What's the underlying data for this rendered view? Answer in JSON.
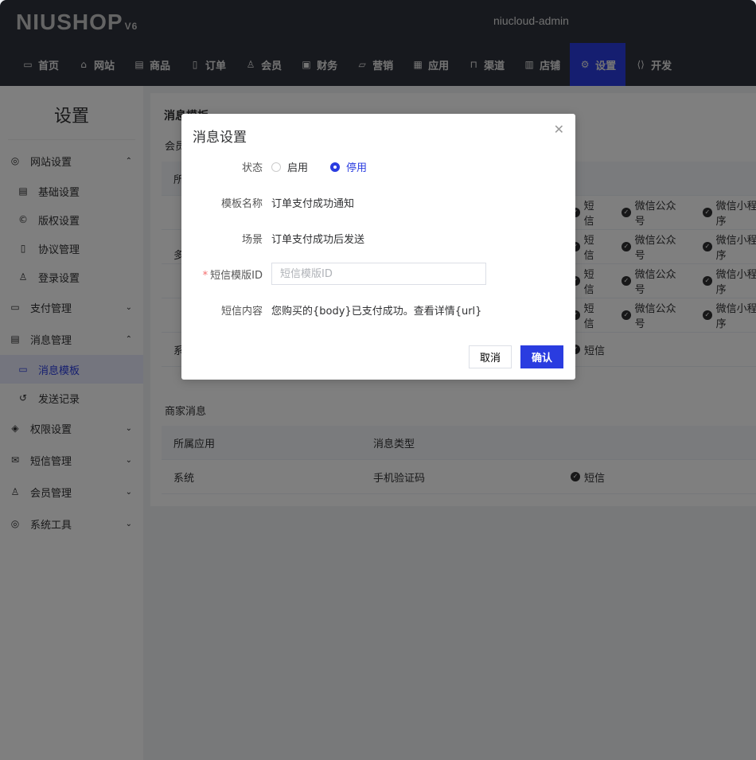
{
  "header": {
    "logo": "NIUSHOP",
    "logo_version": "V6",
    "user": "niucloud-admin",
    "nav": [
      {
        "label": "首页",
        "icon": "monitor-icon"
      },
      {
        "label": "网站",
        "icon": "website-icon"
      },
      {
        "label": "商品",
        "icon": "goods-icon"
      },
      {
        "label": "订单",
        "icon": "order-icon"
      },
      {
        "label": "会员",
        "icon": "member-icon"
      },
      {
        "label": "财务",
        "icon": "finance-icon"
      },
      {
        "label": "营销",
        "icon": "marketing-icon"
      },
      {
        "label": "应用",
        "icon": "app-icon"
      },
      {
        "label": "渠道",
        "icon": "channel-icon"
      },
      {
        "label": "店铺",
        "icon": "store-icon"
      },
      {
        "label": "设置",
        "icon": "gear-icon",
        "active": true
      },
      {
        "label": "开发",
        "icon": "code-icon"
      }
    ]
  },
  "sidebar": {
    "title": "设置",
    "items": [
      {
        "label": "网站设置",
        "icon": "globe-icon"
      },
      {
        "label": "基础设置",
        "icon": "settings-icon"
      },
      {
        "label": "版权设置",
        "icon": "copyright-icon"
      },
      {
        "label": "协议管理",
        "icon": "document-icon"
      },
      {
        "label": "登录设置",
        "icon": "user-icon"
      },
      {
        "label": "支付管理",
        "icon": "wallet-icon"
      },
      {
        "label": "消息管理",
        "icon": "message-icon"
      },
      {
        "label": "消息模板",
        "icon": "chat-icon"
      },
      {
        "label": "发送记录",
        "icon": "history-icon"
      },
      {
        "label": "权限设置",
        "icon": "shield-icon"
      },
      {
        "label": "短信管理",
        "icon": "mail-icon"
      },
      {
        "label": "会员管理",
        "icon": "members-icon"
      },
      {
        "label": "系统工具",
        "icon": "tool-icon"
      }
    ]
  },
  "main": {
    "title": "消息模板",
    "member_section": "会员消息",
    "merchant_section": "商家消息",
    "columns": [
      "所属应用",
      "消息类型"
    ],
    "member_rows": [
      {
        "app": "多",
        "channels": [
          "短信",
          "微信公众号",
          "微信小程序"
        ]
      },
      {
        "channels": [
          "短信",
          "微信公众号",
          "微信小程序"
        ]
      },
      {
        "channels": [
          "短信",
          "微信公众号",
          "微信小程序"
        ]
      },
      {
        "channels": [
          "短信",
          "微信公众号",
          "微信小程序"
        ]
      },
      {
        "app": "系统",
        "channels": [
          "短信"
        ]
      }
    ],
    "merchant_rows": [
      {
        "app": "系统",
        "type": "手机验证码",
        "channels": [
          "短信"
        ]
      }
    ]
  },
  "dialog": {
    "title": "消息设置",
    "status_label": "状态",
    "status_options": [
      "启用",
      "停用"
    ],
    "status_selected": "停用",
    "name_label": "模板名称",
    "name_value": "订单支付成功通知",
    "scene_label": "场景",
    "scene_value": "订单支付成功后发送",
    "id_label": "短信模版ID",
    "id_placeholder": "短信模版ID",
    "id_value": "",
    "content_label": "短信内容",
    "content_value": "您购买的{body}已支付成功。查看详情{url}",
    "cancel": "取消",
    "confirm": "确认"
  },
  "colors": {
    "accent": "#2a3ce0",
    "header": "#2e323c"
  }
}
